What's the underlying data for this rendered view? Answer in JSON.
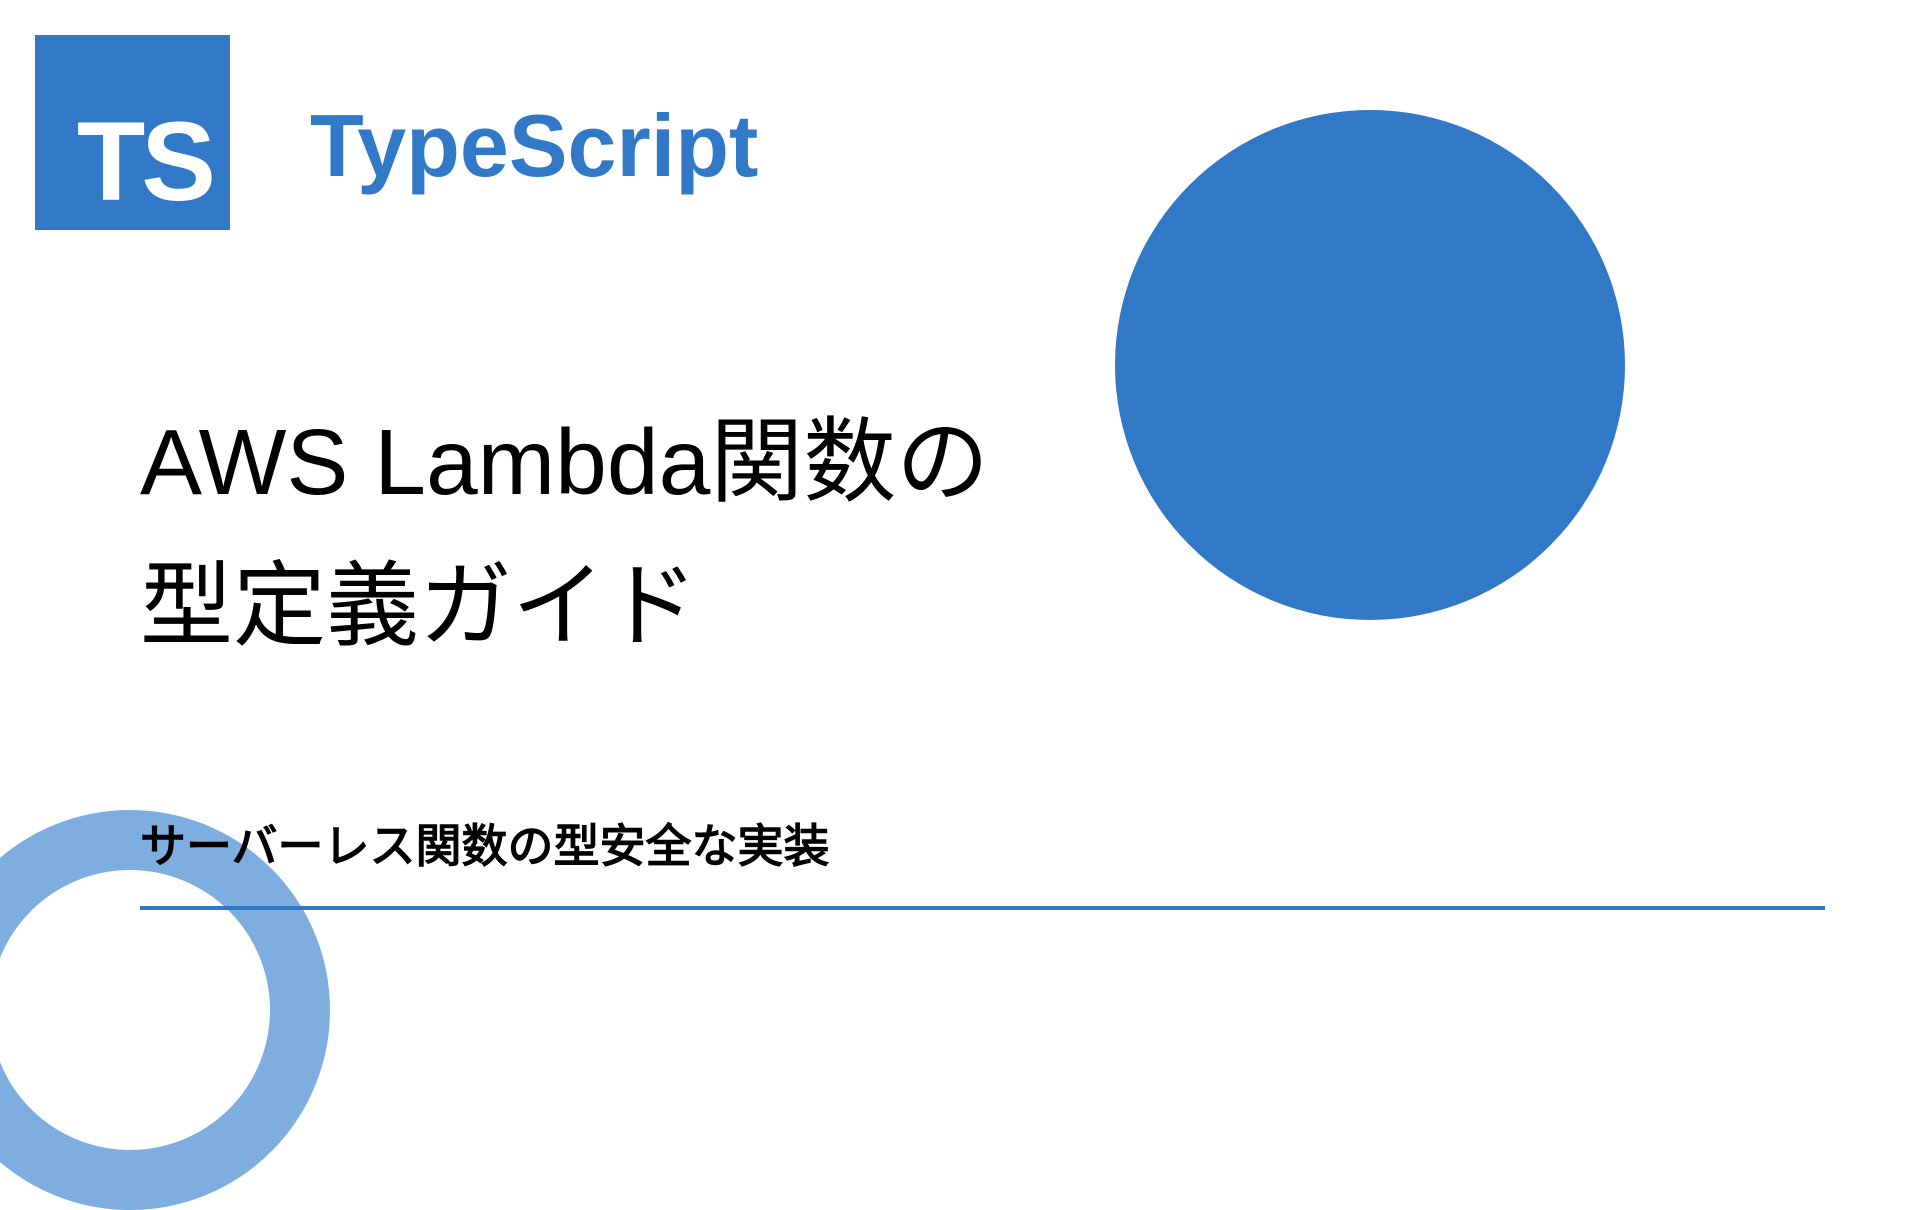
{
  "logo": {
    "text": "TS"
  },
  "language_label": "TypeScript",
  "title_line1": "AWS Lambda関数の",
  "title_line2": "型定義ガイド",
  "subtitle": "サーバーレス関数の型安全な実装",
  "colors": {
    "primary": "#3178c6",
    "ring": "#7eaee0"
  }
}
